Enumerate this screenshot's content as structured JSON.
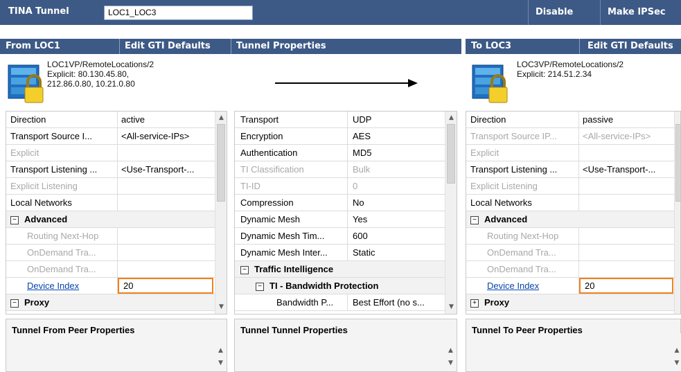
{
  "toolbar": {
    "title": "TINA Tunnel",
    "tunnel_name": "LOC1_LOC3",
    "disable_label": "Disable",
    "make_ipsec_label": "Make IPSec"
  },
  "from_panel": {
    "header": "From LOC1",
    "edit_label": "Edit GTI Defaults",
    "peer_line1": "LOC1VP/RemoteLocations/2",
    "peer_line2": "Explicit: 80.130.45.80,",
    "peer_line3": "212.86.0.80, 10.21.0.80",
    "rows": [
      {
        "name": "Direction",
        "value": "active"
      },
      {
        "name": "Transport Source I...",
        "value": "<All-service-IPs>"
      },
      {
        "name": "Explicit",
        "value": ""
      },
      {
        "name": "Transport Listening ...",
        "value": "<Use-Transport-..."
      },
      {
        "name": "Explicit Listening",
        "value": ""
      },
      {
        "name": "Local Networks",
        "value": ""
      },
      {
        "name": "Advanced",
        "value": ""
      },
      {
        "name": "Routing Next-Hop",
        "value": ""
      },
      {
        "name": "OnDemand Tra...",
        "value": ""
      },
      {
        "name": "OnDemand Tra...",
        "value": ""
      },
      {
        "name": "Device Index",
        "value": "20"
      },
      {
        "name": "Proxy",
        "value": ""
      }
    ],
    "desc_title": "Tunnel From Peer Properties"
  },
  "middle_panel": {
    "header": "Tunnel Properties",
    "rows": [
      {
        "name": "Transport",
        "value": "UDP"
      },
      {
        "name": "Encryption",
        "value": "AES"
      },
      {
        "name": "Authentication",
        "value": "MD5"
      },
      {
        "name": "TI Classification",
        "value": "Bulk"
      },
      {
        "name": "TI-ID",
        "value": "0"
      },
      {
        "name": "Compression",
        "value": "No"
      },
      {
        "name": "Dynamic Mesh",
        "value": "Yes"
      },
      {
        "name": "Dynamic Mesh Tim...",
        "value": "600"
      },
      {
        "name": "Dynamic Mesh Inter...",
        "value": "Static"
      },
      {
        "name": "Traffic Intelligence",
        "value": ""
      },
      {
        "name": "TI - Bandwidth Protection",
        "value": ""
      },
      {
        "name": "Bandwidth P...",
        "value": "Best Effort (no s..."
      }
    ],
    "desc_title": "Tunnel Tunnel Properties"
  },
  "to_panel": {
    "header": "To LOC3",
    "edit_label": "Edit GTI Defaults",
    "peer_line1": "LOC3VP/RemoteLocations/2",
    "peer_line2": "Explicit: 214.51.2.34",
    "rows": [
      {
        "name": "Direction",
        "value": "passive"
      },
      {
        "name": "Transport Source IP...",
        "value": "<All-service-IPs>"
      },
      {
        "name": "Explicit",
        "value": ""
      },
      {
        "name": "Transport Listening ...",
        "value": "<Use-Transport-..."
      },
      {
        "name": "Explicit Listening",
        "value": ""
      },
      {
        "name": "Local Networks",
        "value": ""
      },
      {
        "name": "Advanced",
        "value": ""
      },
      {
        "name": "Routing Next-Hop",
        "value": ""
      },
      {
        "name": "OnDemand Tra...",
        "value": ""
      },
      {
        "name": "OnDemand Tra...",
        "value": ""
      },
      {
        "name": "Device Index",
        "value": "20"
      },
      {
        "name": "Proxy",
        "value": ""
      }
    ],
    "desc_title": "Tunnel To Peer Properties"
  },
  "colors": {
    "header_bg": "#3d5a86",
    "selection_border": "#f0821e",
    "link": "#0645ad"
  },
  "icons": [
    "firewall-lock-icon",
    "arrow-right-icon",
    "scroll-up-icon",
    "scroll-down-icon",
    "collapse-icon",
    "expand-icon"
  ]
}
